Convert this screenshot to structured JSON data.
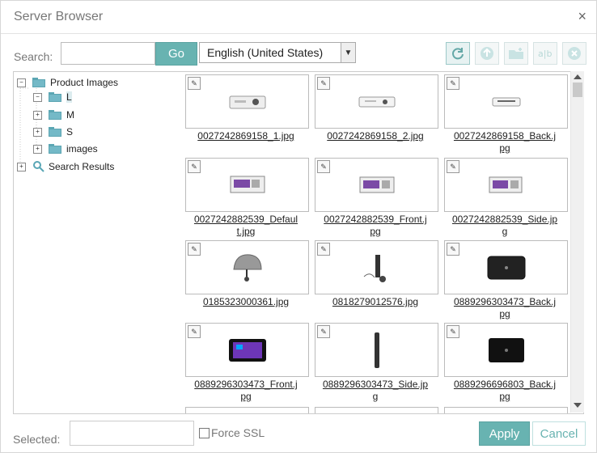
{
  "window": {
    "title": "Server Browser",
    "close_symbol": "×"
  },
  "toolbar": {
    "search_label": "Search:",
    "search_value": "",
    "search_placeholder": "",
    "go_label": "Go",
    "language_value": "English (United States)",
    "actions": [
      "refresh-icon",
      "upload-icon",
      "new-folder-icon",
      "rename-icon",
      "delete-icon"
    ]
  },
  "tree": {
    "root_label": "Product Images",
    "folders": [
      {
        "label": "L",
        "selected": true
      },
      {
        "label": "M",
        "selected": false
      },
      {
        "label": "S",
        "selected": false
      },
      {
        "label": "images",
        "selected": false
      }
    ],
    "search_label": "Search Results"
  },
  "files": [
    {
      "line1": "0027242869158_1.jpg",
      "line2": ""
    },
    {
      "line1": "0027242869158_2.jpg",
      "line2": ""
    },
    {
      "line1": "0027242869158_Back.j",
      "line2": "pg"
    },
    {
      "line1": "0027242882539_Defaul",
      "line2": "t.jpg"
    },
    {
      "line1": "0027242882539_Front.j",
      "line2": "pg"
    },
    {
      "line1": "0027242882539_Side.jp",
      "line2": "g"
    },
    {
      "line1": "0185323000361.jpg",
      "line2": ""
    },
    {
      "line1": "0818279012576.jpg",
      "line2": ""
    },
    {
      "line1": "0889296303473_Back.j",
      "line2": "pg"
    },
    {
      "line1": "0889296303473_Front.j",
      "line2": "pg"
    },
    {
      "line1": "0889296303473_Side.jp",
      "line2": "g"
    },
    {
      "line1": "0889296696803_Back.j",
      "line2": "pg"
    }
  ],
  "footer": {
    "selected_label": "Selected:",
    "selected_value": "",
    "force_ssl_label": "Force SSL",
    "force_ssl_checked": false,
    "apply_label": "Apply",
    "cancel_label": "Cancel"
  },
  "colors": {
    "accent": "#68b3b1",
    "text": "#333333",
    "border": "#cccccc"
  }
}
